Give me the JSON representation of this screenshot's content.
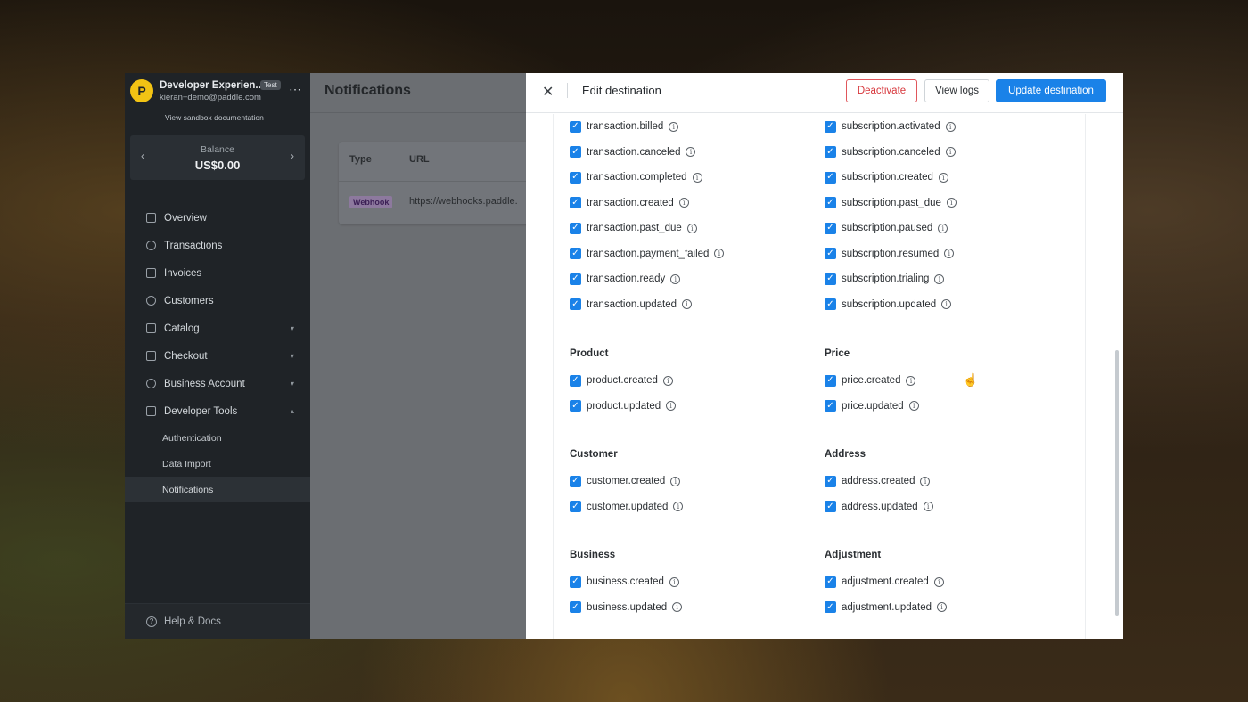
{
  "sidebar": {
    "account_name": "Developer Experien...",
    "account_badge": "Test",
    "account_email": "kieran+demo@paddle.com",
    "sandbox_link": "View sandbox documentation",
    "logo_letter": "P",
    "balance_label": "Balance",
    "balance_value": "US$0.00",
    "nav": [
      {
        "label": "Overview",
        "icon": "overview-icon"
      },
      {
        "label": "Transactions",
        "icon": "dollar-icon"
      },
      {
        "label": "Invoices",
        "icon": "invoice-icon"
      },
      {
        "label": "Customers",
        "icon": "customers-icon"
      },
      {
        "label": "Catalog",
        "icon": "catalog-icon"
      },
      {
        "label": "Checkout",
        "icon": "card-icon"
      },
      {
        "label": "Business Account",
        "icon": "account-icon"
      },
      {
        "label": "Developer Tools",
        "icon": "tools-icon"
      }
    ],
    "sub_nav": [
      "Authentication",
      "Data Import",
      "Notifications"
    ],
    "help": "Help & Docs"
  },
  "main": {
    "title": "Notifications",
    "col_type": "Type",
    "col_url": "URL",
    "row_type": "Webhook",
    "row_url": "https://webhooks.paddle."
  },
  "drawer": {
    "title": "Edit destination",
    "deactivate": "Deactivate",
    "view_logs": "View logs",
    "update": "Update destination",
    "transaction_events": [
      "transaction.billed",
      "transaction.canceled",
      "transaction.completed",
      "transaction.created",
      "transaction.past_due",
      "transaction.payment_failed",
      "transaction.ready",
      "transaction.updated"
    ],
    "subscription_events": [
      "subscription.activated",
      "subscription.canceled",
      "subscription.created",
      "subscription.past_due",
      "subscription.paused",
      "subscription.resumed",
      "subscription.trialing",
      "subscription.updated"
    ],
    "groups": {
      "product": {
        "title": "Product",
        "events": [
          "product.created",
          "product.updated"
        ]
      },
      "price": {
        "title": "Price",
        "events": [
          "price.created",
          "price.updated"
        ]
      },
      "customer": {
        "title": "Customer",
        "events": [
          "customer.created",
          "customer.updated"
        ]
      },
      "address": {
        "title": "Address",
        "events": [
          "address.created",
          "address.updated"
        ]
      },
      "business": {
        "title": "Business",
        "events": [
          "business.created",
          "business.updated"
        ]
      },
      "adjustment": {
        "title": "Adjustment",
        "events": [
          "adjustment.created",
          "adjustment.updated"
        ]
      }
    },
    "accent_color": "#1a82e8"
  }
}
